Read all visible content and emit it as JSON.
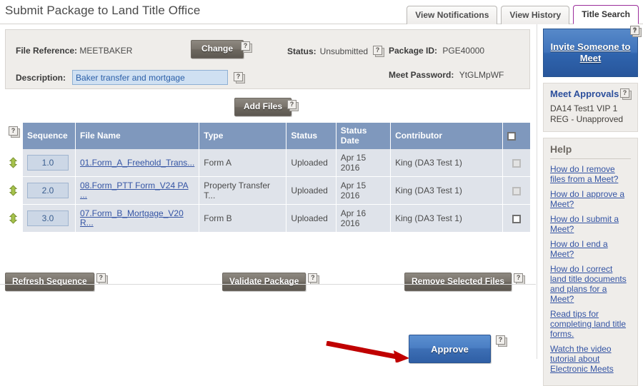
{
  "header": {
    "title": "Submit Package to Land Title Office",
    "tabs": [
      {
        "label": "View Notifications",
        "active": false
      },
      {
        "label": "View History",
        "active": false
      },
      {
        "label": "Title Search",
        "active": true
      }
    ],
    "active_tab_accent": "#9b2d9b"
  },
  "info": {
    "file_reference_label": "File Reference:",
    "file_reference_value": "MEETBAKER",
    "change_button": "Change",
    "status_label": "Status:",
    "status_value": "Unsubmitted",
    "package_id_label": "Package ID:",
    "package_id_value": "PGE40000",
    "description_label": "Description:",
    "description_value": "Baker transfer and mortgage",
    "meet_password_label": "Meet Password:",
    "meet_password_value": "YtGLMpWF",
    "panel_bg": "#efedea"
  },
  "toolbar": {
    "add_files_label": "Add Files",
    "help_icon_glyph": "?"
  },
  "table": {
    "columns": [
      "Sequence",
      "File Name",
      "Type",
      "Status",
      "Status Date",
      "Contributor"
    ],
    "header_bg": "#7f98bd",
    "row_bg": "#dfe3ea",
    "rows": [
      {
        "sequence": "1.0",
        "file_name": "01.Form_A_Freehold_Trans...",
        "type": "Form A",
        "status": "Uploaded",
        "status_date": "Apr 15 2016",
        "contributor": "King (DA3 Test 1)",
        "checkbox_enabled": false,
        "checked": false
      },
      {
        "sequence": "2.0",
        "file_name": "08.Form_PTT Form_V24 PA ...",
        "type": "Property Transfer T...",
        "status": "Uploaded",
        "status_date": "Apr 15 2016",
        "contributor": "King (DA3 Test 1)",
        "checkbox_enabled": false,
        "checked": false
      },
      {
        "sequence": "3.0",
        "file_name": "07.Form_B_Mortgage_V20 R...",
        "type": "Form B",
        "status": "Uploaded",
        "status_date": "Apr 16 2016",
        "contributor": "King (DA3 Test 1)",
        "checkbox_enabled": true,
        "checked": false
      }
    ],
    "select_all_checked": false
  },
  "actions": {
    "refresh_sequence": "Refresh Sequence",
    "validate_package": "Validate Package",
    "remove_selected_files": "Remove Selected Files",
    "approve": "Approve",
    "arrow_color": "#c00000"
  },
  "sidebar": {
    "invite_button": "Invite Someone to Meet",
    "meet_approvals_title": "Meet Approvals",
    "meet_approvals_items": [
      "DA14 Test1 VIP 1 REG - Unapproved"
    ],
    "help_title": "Help",
    "help_links": [
      "How do I remove files from a Meet?",
      "How do I approve a Meet?",
      "How do I submit a Meet?",
      "How do I end a Meet?",
      "How do I correct land title documents and plans for a Meet?",
      "Read tips for completing land title forms.",
      "Watch the video tutorial about Electronic Meets"
    ]
  }
}
